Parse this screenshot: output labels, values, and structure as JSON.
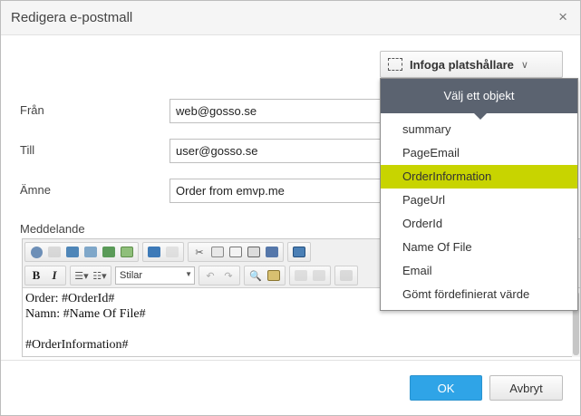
{
  "dialog": {
    "title": "Redigera e-postmall",
    "close_glyph": "×"
  },
  "placeholder_button": {
    "label": "Infoga platshållare",
    "chevron": "∨"
  },
  "fields": {
    "from": {
      "label": "Från",
      "value": "web@gosso.se"
    },
    "to": {
      "label": "Till",
      "value": "user@gosso.se"
    },
    "subject": {
      "label": "Ämne",
      "value": "Order from emvp.me"
    }
  },
  "message": {
    "label": "Meddelande",
    "style_select": "Stilar",
    "content_lines": [
      "Order: #OrderId#",
      "Namn: #Name Of File#",
      "",
      "#OrderInformation#"
    ]
  },
  "toolbar_icons": {
    "row1": [
      "preview-icon",
      "template-icon",
      "image-icon",
      "embed-icon",
      "table-icon",
      "media-icon",
      "anchor-icon",
      "code-icon",
      "cut-icon",
      "copy-icon",
      "paste-icon",
      "paste-text-icon",
      "paste-word-icon",
      "fullscreen-icon"
    ],
    "row2": [
      "bold-icon",
      "italic-icon",
      "bullet-list-icon",
      "number-list-icon",
      "undo-icon",
      "redo-icon",
      "find-icon",
      "spellcheck-icon",
      "table-insert-icon",
      "table-delete-icon",
      "indent-icon"
    ]
  },
  "dropdown": {
    "header": "Välj ett objekt",
    "items": [
      "summary",
      "PageEmail",
      "OrderInformation",
      "PageUrl",
      "OrderId",
      "Name Of File",
      "Email",
      "Gömt fördefinierat värde"
    ],
    "active_index": 2
  },
  "footer": {
    "ok_label": "OK",
    "cancel_label": "Avbryt"
  },
  "colors": {
    "primary": "#2fa4e7",
    "highlight": "#c8d400",
    "dropdown_header": "#5b6370"
  }
}
